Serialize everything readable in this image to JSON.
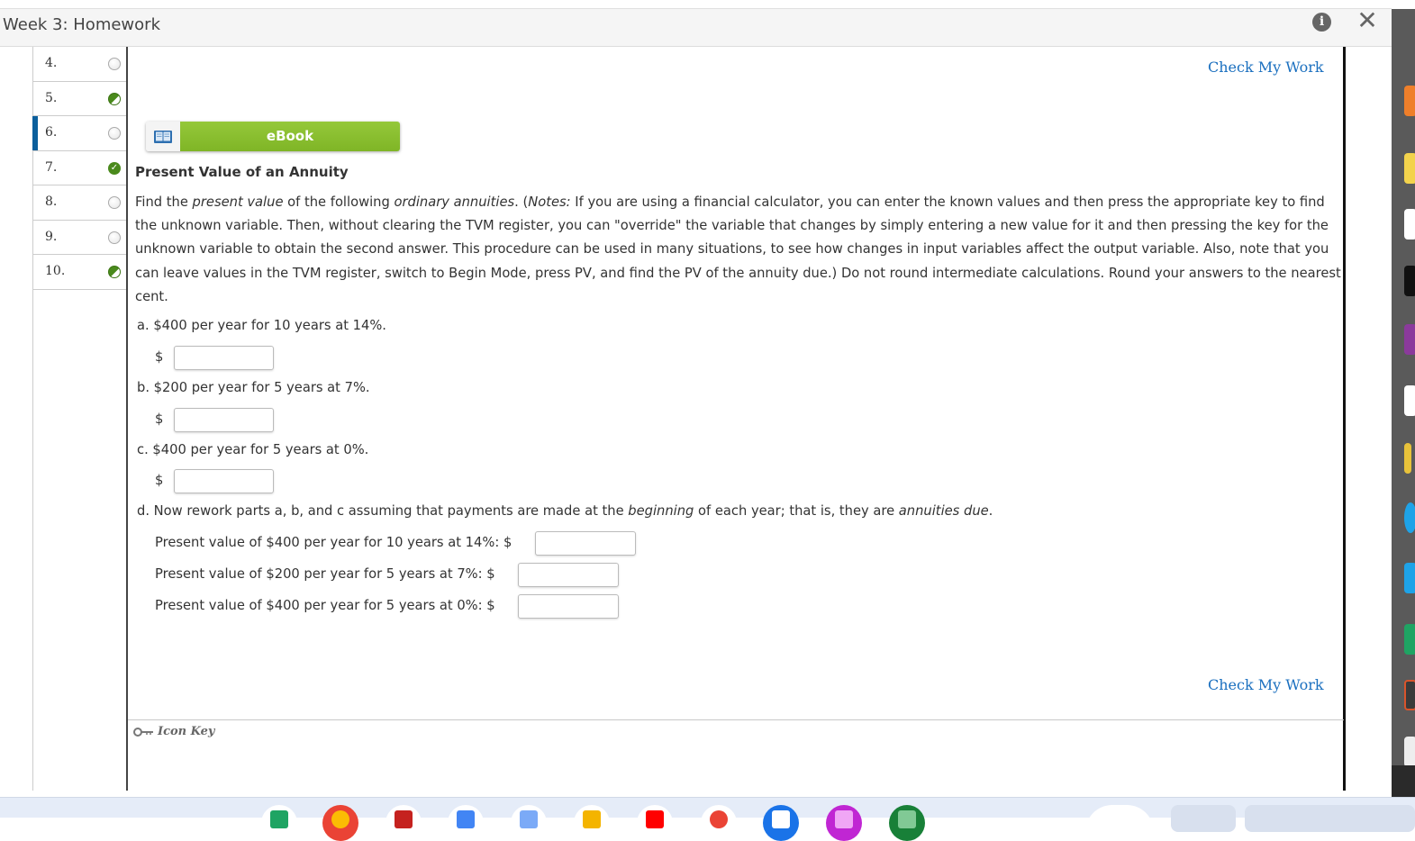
{
  "window": {
    "title": "Week 3: Homework",
    "info_icon": "info-icon",
    "close_icon": "close-icon"
  },
  "sidebar": {
    "questions": [
      {
        "label": "4.",
        "status": "empty",
        "active": false
      },
      {
        "label": "5.",
        "status": "partial",
        "active": false
      },
      {
        "label": "6.",
        "status": "empty",
        "active": true
      },
      {
        "label": "7.",
        "status": "full",
        "active": false
      },
      {
        "label": "8.",
        "status": "empty",
        "active": false
      },
      {
        "label": "9.",
        "status": "empty",
        "active": false
      },
      {
        "label": "10.",
        "status": "partial",
        "active": false
      }
    ]
  },
  "actions": {
    "check_my_work_top": "Check My Work",
    "check_my_work_bottom": "Check My Work",
    "ebook_label": "eBook"
  },
  "question": {
    "title": "Present Value of an Annuity",
    "intro_1": "Find the ",
    "intro_em_1": "present value",
    "intro_2": " of the following ",
    "intro_em_2": "ordinary annuities",
    "intro_3": ". (",
    "intro_em_3": "Notes:",
    "intro_4": " If you are using a financial calculator, you can enter the known values and then press the appropriate key to find the unknown variable. Then, without clearing the TVM register, you can \"override\" the variable that changes by simply entering a new value for it and then pressing the key for the unknown variable to obtain the second answer. This procedure can be used in many situations, to see how changes in input variables affect the output variable. Also, note that you can leave values in the TVM register, switch to Begin Mode, press PV, and find the PV of the annuity due.) Do not round intermediate calculations. Round your answers to the nearest cent.",
    "parts": [
      {
        "letter": "a.",
        "text": " $400 per year for 10 years at 14%.",
        "currency": "$",
        "value": ""
      },
      {
        "letter": "b.",
        "text": " $200 per year for 5 years at 7%.",
        "currency": "$",
        "value": ""
      },
      {
        "letter": "c.",
        "text": " $400 per year for 5 years at 0%.",
        "currency": "$",
        "value": ""
      }
    ],
    "part_d": {
      "letter": "d.",
      "text_1": " Now rework parts a, b, and c assuming that payments are made at the ",
      "em_1": "beginning",
      "text_2": " of each year; that is, they are ",
      "em_2": "annuities due",
      "text_3": ".",
      "rows": [
        {
          "label": "Present value of $400 per year for 10 years at 14%: $",
          "value": ""
        },
        {
          "label": "Present value of $200 per year for 5 years at 7%: $",
          "value": ""
        },
        {
          "label": "Present value of $400 per year for 5 years at 0%: $",
          "value": ""
        }
      ]
    }
  },
  "footer": {
    "icon_key_label": "Icon Key"
  },
  "colors": {
    "accent_link": "#1a6fbf",
    "ebook_green": "#8cc63f",
    "active_marker": "#0b5f9c",
    "complete_green": "#4a8a1c"
  }
}
